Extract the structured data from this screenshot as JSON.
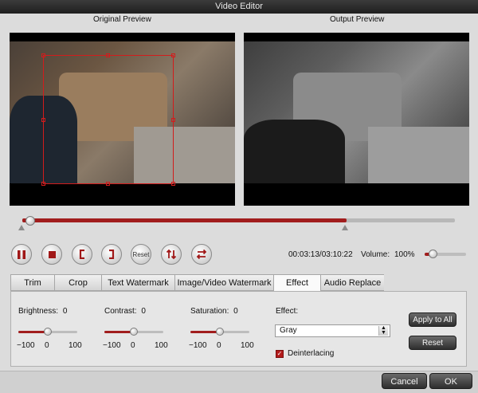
{
  "window": {
    "title": "Video Editor"
  },
  "preview": {
    "original_label": "Original Preview",
    "output_label": "Output Preview"
  },
  "playback": {
    "progress": 0.75,
    "start_marker": 0.0,
    "end_marker": 0.75,
    "time_text": "00:03:13/03:10:22",
    "volume_label": "Volume:",
    "volume_value": "100%",
    "volume_level": 0.2,
    "reset_label": "Reset"
  },
  "tabs": [
    {
      "label": "Trim"
    },
    {
      "label": "Crop"
    },
    {
      "label": "Text Watermark"
    },
    {
      "label": "Image/Video Watermark"
    },
    {
      "label": "Effect"
    },
    {
      "label": "Audio Replace"
    }
  ],
  "active_tab": "Effect",
  "effect": {
    "brightness": {
      "label": "Brightness:",
      "value": "0",
      "level": 0.5
    },
    "contrast": {
      "label": "Contrast:",
      "value": "0",
      "level": 0.5
    },
    "saturation": {
      "label": "Saturation:",
      "value": "0",
      "level": 0.5
    },
    "ticks": {
      "min": "−100",
      "mid": "0",
      "max": "100"
    },
    "effect_label": "Effect:",
    "effect_value": "Gray",
    "deinterlacing_label": "Deinterlacing",
    "deinterlacing_checked": true,
    "apply_all_label": "Apply to All",
    "reset_label": "Reset"
  },
  "footer": {
    "cancel_label": "Cancel",
    "ok_label": "OK"
  },
  "colors": {
    "accent": "#a11d1d",
    "crop_box": "#d21c1c"
  }
}
